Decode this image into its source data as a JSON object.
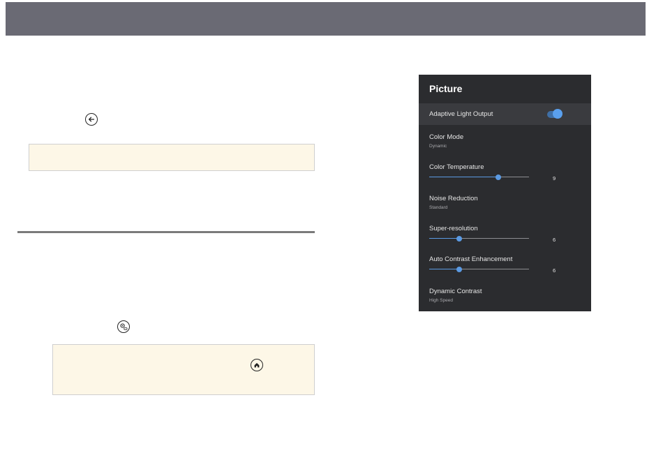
{
  "icons": {
    "back": "back-arrow-icon",
    "settings": "settings-icon",
    "home": "home-icon"
  },
  "panel": {
    "title": "Picture",
    "items": [
      {
        "label": "Adaptive Light Output",
        "type": "toggle",
        "on": true
      },
      {
        "label": "Color Mode",
        "sub": "Dynamic"
      },
      {
        "label": "Color Temperature",
        "type": "slider",
        "value": "9",
        "level": 0.69
      },
      {
        "label": "Noise Reduction",
        "sub": "Standard"
      },
      {
        "label": "Super-resolution",
        "type": "slider",
        "value": "6",
        "level": 0.3
      },
      {
        "label": "Auto Contrast Enhancement",
        "type": "slider",
        "value": "6",
        "level": 0.3
      },
      {
        "label": "Dynamic Contrast",
        "sub": "High Speed"
      }
    ]
  },
  "colors": {
    "topbar": "#6a6a74",
    "panel_bg": "#2b2c2f",
    "accent": "#5b9ae3",
    "note_bg": "#fdf7e7"
  }
}
